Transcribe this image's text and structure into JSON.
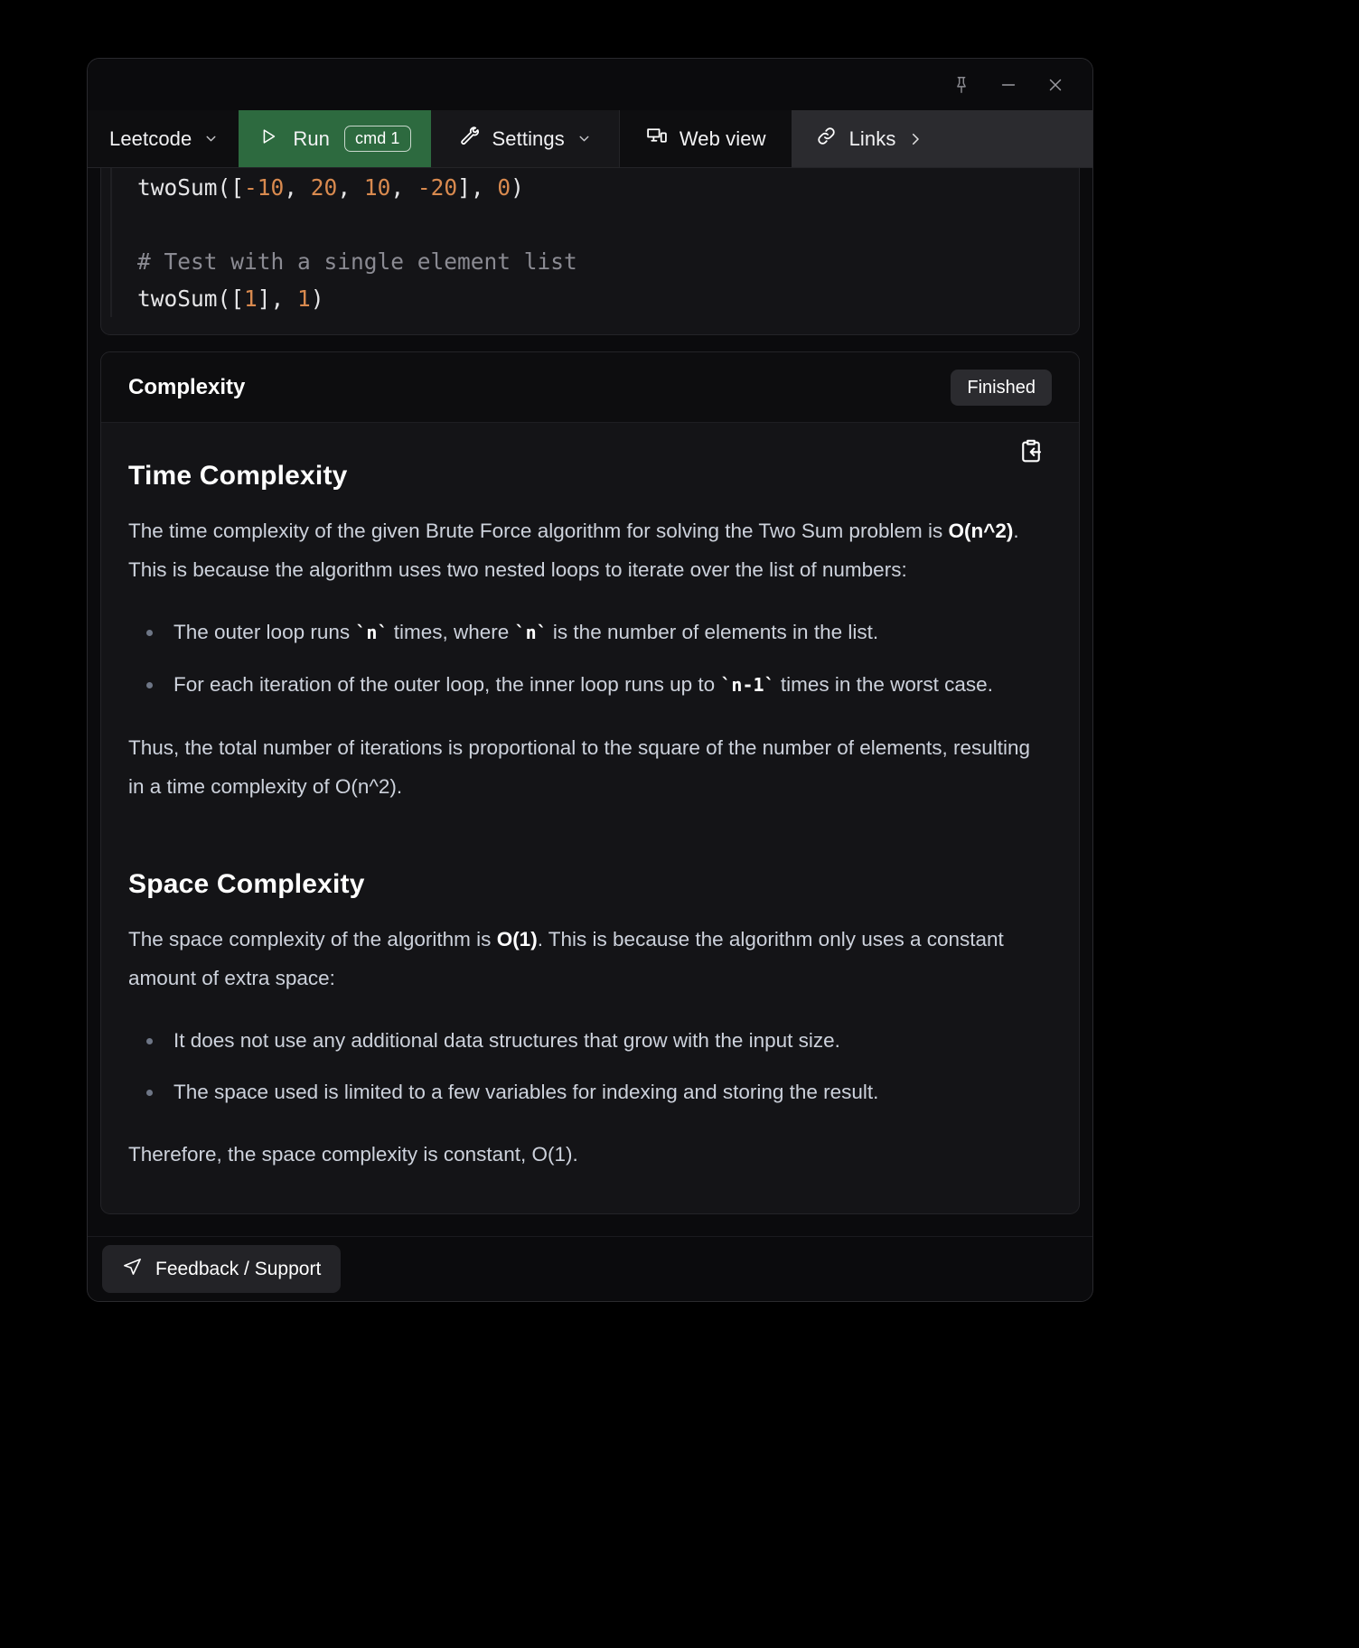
{
  "window": {
    "controls": [
      {
        "name": "pin",
        "label": "Pin"
      },
      {
        "name": "minimize",
        "label": "Minimize"
      },
      {
        "name": "close",
        "label": "Close"
      }
    ]
  },
  "toolbar": {
    "leetcode_label": "Leetcode",
    "run_label": "Run",
    "run_shortcut": "cmd 1",
    "run_bg_color": "#2d6a3f",
    "settings_label": "Settings",
    "webview_label": "Web view",
    "links_label": "Links"
  },
  "code": {
    "line1_prefix": "twoSum([",
    "line1_n1": "-10",
    "line1_sep1": ", ",
    "line1_n2": "20",
    "line1_sep2": ", ",
    "line1_n3": "10",
    "line1_sep3": ", ",
    "line1_n4": "-20",
    "line1_mid": "], ",
    "line1_n5": "0",
    "line1_suffix": ")",
    "comment": "# Test with a single element list",
    "line2_prefix": "twoSum([",
    "line2_n1": "1",
    "line2_mid": "], ",
    "line2_n2": "1",
    "line2_suffix": ")"
  },
  "complexity": {
    "header_title": "Complexity",
    "status_badge": "Finished",
    "copy_icon": "clipboard-paste-icon",
    "time": {
      "heading": "Time Complexity",
      "para_a": "The time complexity of the given Brute Force algorithm for solving the Two Sum problem is ",
      "para_a_bold": "O(n^2)",
      "para_a_rest": ". This is because the algorithm uses two nested loops to iterate over the list of numbers:",
      "bullets": [
        {
          "t1": "The outer loop runs ",
          "c1": "`n`",
          "t2": " times, where ",
          "c2": "`n`",
          "t3": " is the number of elements in the list."
        },
        {
          "t1": "For each iteration of the outer loop, the inner loop runs up to ",
          "c1": "`n-1`",
          "t2": " times in the worst case.",
          "c2": "",
          "t3": ""
        }
      ],
      "conclusion": "Thus, the total number of iterations is proportional to the square of the number of elements, resulting in a time complexity of O(n^2)."
    },
    "space": {
      "heading": "Space Complexity",
      "para_a": "The space complexity of the algorithm is ",
      "para_a_bold": "O(1)",
      "para_a_rest": ". This is because the algorithm only uses a constant amount of extra space:",
      "bullets": [
        "It does not use any additional data structures that grow with the input size.",
        "The space used is limited to a few variables for indexing and storing the result."
      ],
      "conclusion": "Therefore, the space complexity is constant, O(1)."
    }
  },
  "footer": {
    "feedback_label": "Feedback / Support",
    "feedback_icon": "send-icon"
  }
}
